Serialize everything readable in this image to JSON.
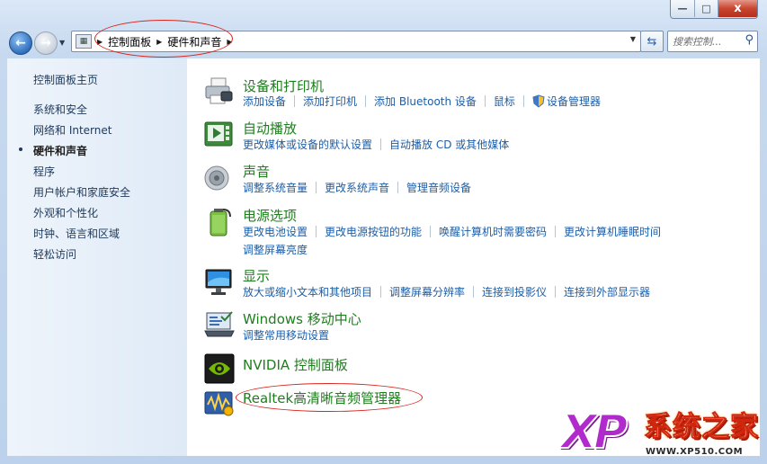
{
  "window": {
    "controls": {
      "minimize": "—",
      "maximize": "□",
      "close": "x"
    }
  },
  "nav": {
    "back_icon": "back-arrow-icon",
    "forward_icon": "forward-arrow-icon",
    "breadcrumb": [
      "控制面板",
      "硬件和声音"
    ],
    "search_placeholder": "搜索控制..."
  },
  "sidebar": {
    "home": "控制面板主页",
    "items": [
      {
        "label": "系统和安全"
      },
      {
        "label": "网络和 Internet"
      },
      {
        "label": "硬件和声音",
        "current": true
      },
      {
        "label": "程序"
      },
      {
        "label": "用户帐户和家庭安全"
      },
      {
        "label": "外观和个性化"
      },
      {
        "label": "时钟、语言和区域"
      },
      {
        "label": "轻松访问"
      }
    ]
  },
  "categories": [
    {
      "title": "设备和打印机",
      "icon": "printer-icon",
      "links": [
        "添加设备",
        "添加打印机",
        "添加 Bluetooth 设备",
        "鼠标",
        "设备管理器"
      ]
    },
    {
      "title": "自动播放",
      "icon": "autoplay-icon",
      "links": [
        "更改媒体或设备的默认设置",
        "自动播放 CD 或其他媒体"
      ]
    },
    {
      "title": "声音",
      "icon": "speaker-icon",
      "links": [
        "调整系统音量",
        "更改系统声音",
        "管理音频设备"
      ]
    },
    {
      "title": "电源选项",
      "icon": "battery-icon",
      "links": [
        "更改电池设置",
        "更改电源按钮的功能",
        "唤醒计算机时需要密码",
        "更改计算机睡眠时间",
        "调整屏幕亮度"
      ]
    },
    {
      "title": "显示",
      "icon": "monitor-icon",
      "links": [
        "放大或缩小文本和其他项目",
        "调整屏幕分辨率",
        "连接到投影仪",
        "连接到外部显示器"
      ]
    },
    {
      "title": "Windows 移动中心",
      "icon": "mobility-center-icon",
      "links": [
        "调整常用移动设置"
      ]
    },
    {
      "title": "NVIDIA 控制面板",
      "icon": "nvidia-icon",
      "links": []
    },
    {
      "title": "Realtek高清晰音频管理器",
      "icon": "realtek-audio-icon",
      "links": []
    }
  ],
  "watermark": {
    "logo": "XP",
    "name": "系统之家",
    "url": "WWW.XP510.COM"
  },
  "colors": {
    "link": "#1c5ea8",
    "category_title": "#1e7e1e",
    "annotation": "#d9251b"
  }
}
